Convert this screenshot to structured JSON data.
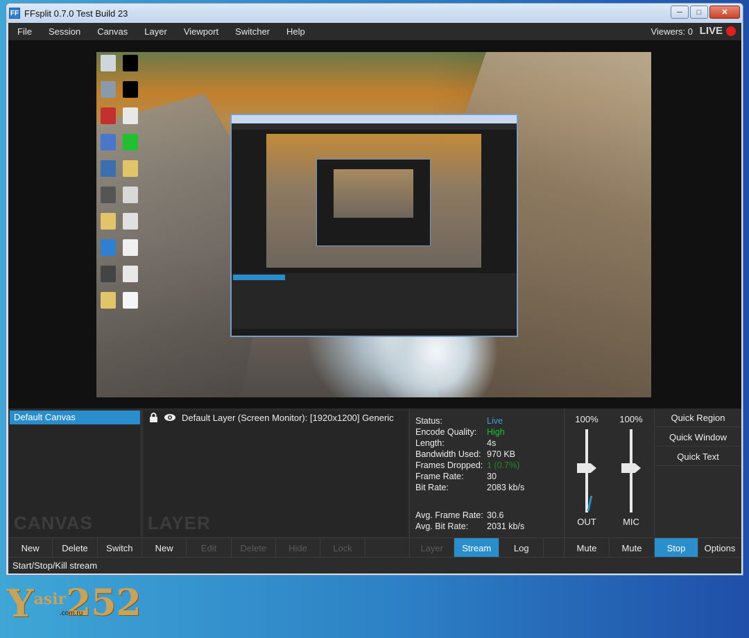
{
  "window": {
    "title": "FFsplit 0.7.0 Test Build 23",
    "app_icon": "FF"
  },
  "menu": {
    "items": [
      "File",
      "Session",
      "Canvas",
      "Layer",
      "Viewport",
      "Switcher",
      "Help"
    ]
  },
  "header": {
    "viewers": "Viewers: 0",
    "live_label": "LIVE",
    "live_color": "#e02020"
  },
  "canvas_panel": {
    "items": [
      "Default Canvas"
    ],
    "watermark": "CANVAS",
    "buttons": [
      "New",
      "Delete",
      "Switch"
    ]
  },
  "layer_panel": {
    "items": [
      {
        "label": "Default Layer (Screen Monitor): [1920x1200] Generic",
        "locked": true,
        "visible": true
      }
    ],
    "watermark": "LAYER",
    "buttons": [
      "New",
      "Edit",
      "Delete",
      "Hide",
      "Lock",
      ""
    ]
  },
  "stats": {
    "status_label": "Status:",
    "status_value": "Live",
    "quality_label": "Encode Quality:",
    "quality_value": "High",
    "length_label": "Length:",
    "length_value": "4s",
    "bandwidth_label": "Bandwidth Used:",
    "bandwidth_value": "970 KB",
    "dropped_label": "Frames Dropped:",
    "dropped_value": "1 (0.7%)",
    "framerate_label": "Frame Rate:",
    "framerate_value": "30",
    "bitrate_label": "Bit Rate:",
    "bitrate_value": "2083 kb/s",
    "avg_framerate_label": "Avg. Frame Rate:",
    "avg_framerate_value": "30.6",
    "avg_bitrate_label": "Avg. Bit Rate:",
    "avg_bitrate_value": "2031 kb/s",
    "tabs": [
      "Layer",
      "Stream",
      "Log",
      ""
    ],
    "active_tab": "Stream"
  },
  "mixer": {
    "out": {
      "percent": "100%",
      "label": "OUT",
      "level": 1.0
    },
    "mic": {
      "percent": "100%",
      "label": "MIC",
      "level": 1.0
    },
    "buttons": [
      "Mute",
      "Mute"
    ]
  },
  "quick": {
    "buttons": [
      "Quick Region",
      "Quick Window",
      "Quick Text"
    ],
    "bottom_buttons": [
      "Stop",
      "Options"
    ]
  },
  "status_bar": {
    "text": "Start/Stop/Kill stream"
  },
  "colors": {
    "accent": "#2a8ecc",
    "panel_bg": "#2c2c2c",
    "green": "#20c030"
  },
  "watermark_logo": {
    "big": "Y",
    "small": "asir",
    "domain": ".com.ru",
    "number": "252"
  }
}
